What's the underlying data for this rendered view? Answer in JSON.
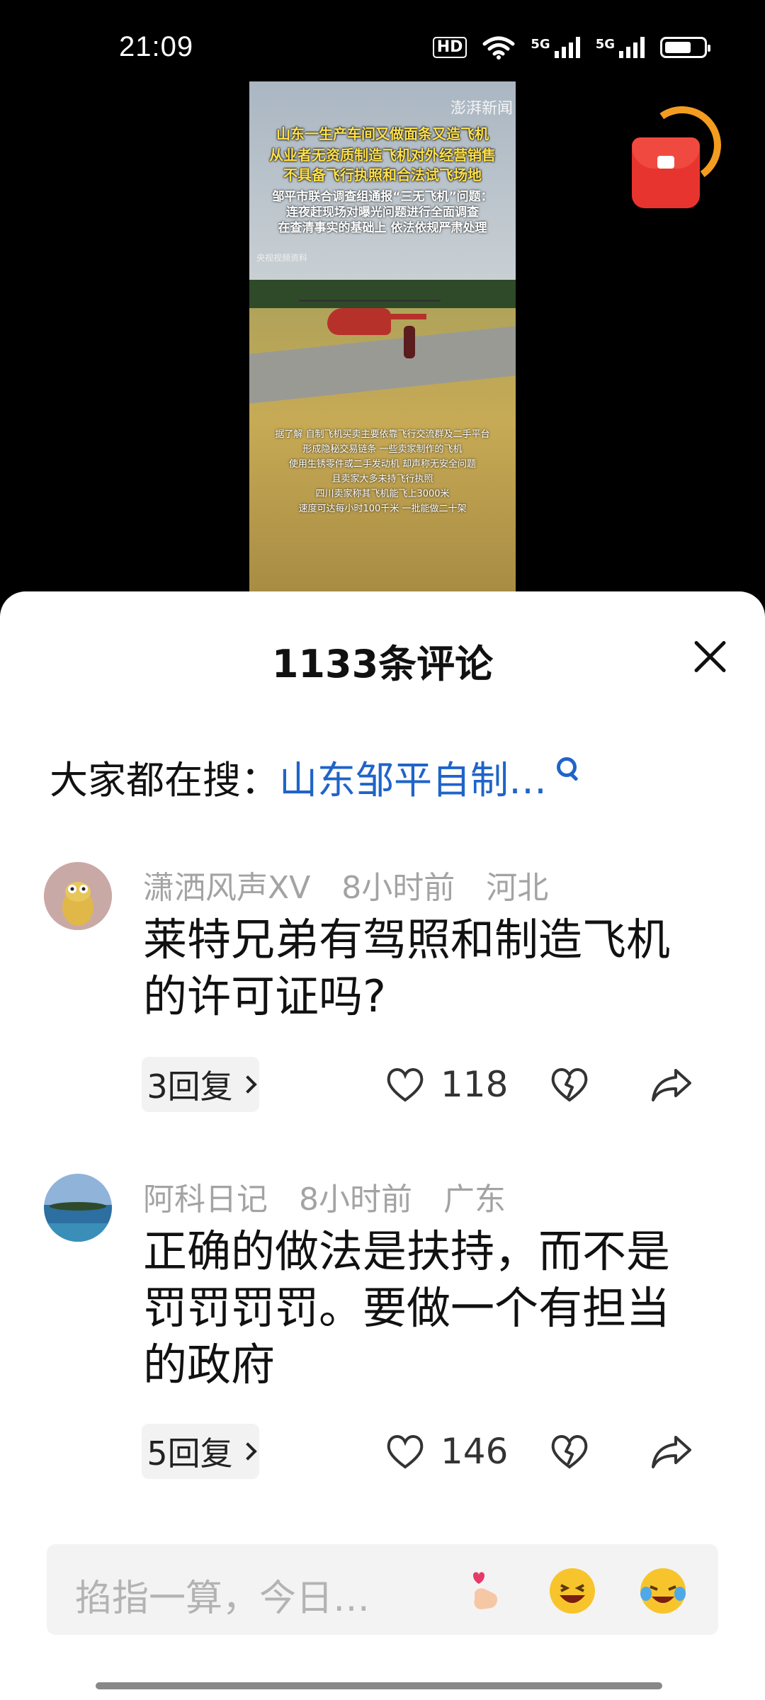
{
  "status_bar": {
    "time": "21:09",
    "hd_label": "HD",
    "signal1_label": "5G",
    "signal2_label": "5G",
    "battery_percent": 70
  },
  "video": {
    "watermark": "澎湃新闻",
    "headline": [
      "山东一生产车间又做面条又造飞机",
      "从业者无资质制造飞机对外经营销售",
      "不具备飞行执照和合法试飞场地"
    ],
    "notice": [
      "邹平市联合调查组通报“三无飞机”问题：",
      "连夜赶现场对曝光问题进行全面调查",
      "在查清事实的基础上 依法依规严肃处理"
    ],
    "source": "央视视频资料",
    "caption": [
      "据了解 自制飞机买卖主要依靠飞行交流群及二手平台",
      "形成隐秘交易链条 一些卖家制作的飞机",
      "使用生锈零件或二手发动机 却声称无安全问题",
      "且卖家大多未持飞行执照",
      "四川卖家称其飞机能飞上3000米",
      "速度可达每小时100千米 一批能做二十架"
    ]
  },
  "red_packet_icon": "red-packet-icon",
  "sheet": {
    "title": "1133条评论",
    "search_label": "大家都在搜：",
    "search_keyword": "山东邹平自制…"
  },
  "comments": [
    {
      "user": "潇洒风声XV",
      "time": "8小时前",
      "location": "河北",
      "text": "莱特兄弟有驾照和制造飞机的许可证吗?",
      "replies": "3回复",
      "likes": "118"
    },
    {
      "user": "阿科日记",
      "time": "8小时前",
      "location": "广东",
      "text": "正确的做法是扶持，而不是罚罚罚罚。要做一个有担当的政府",
      "replies": "5回复",
      "likes": "146"
    }
  ],
  "input": {
    "placeholder": "掐指一算，今日…"
  },
  "colors": {
    "link_blue": "#1f64c8",
    "red": "#e8342e",
    "orange": "#f39c1f"
  }
}
